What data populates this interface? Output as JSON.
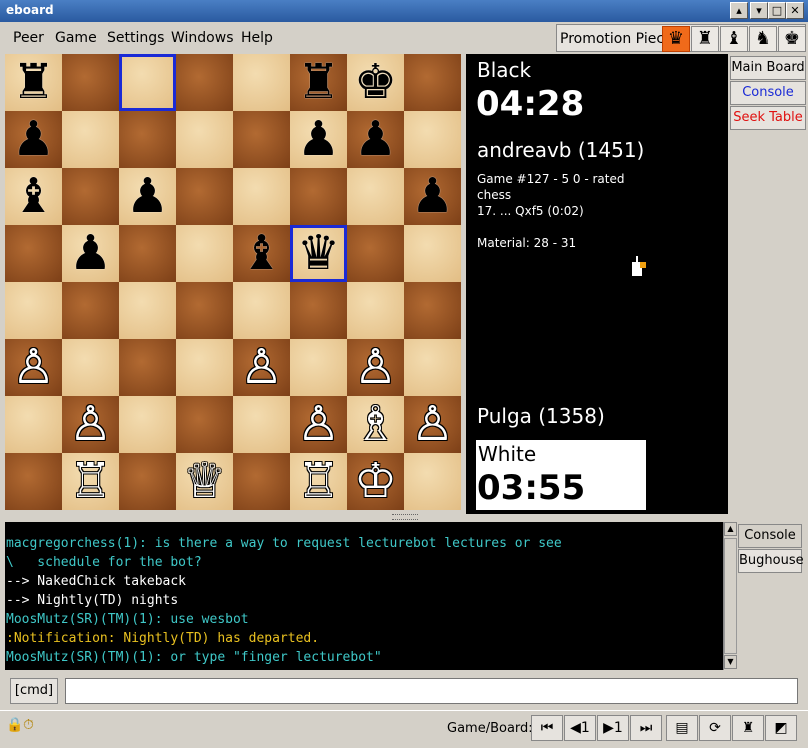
{
  "window": {
    "title": "eboard",
    "min_icon": "▾",
    "max_icon": "□",
    "close_icon": "✕",
    "shade_icon": "▴"
  },
  "menubar": {
    "items": [
      {
        "label": "Peer"
      },
      {
        "label": "Game"
      },
      {
        "label": "Settings"
      },
      {
        "label": "Windows"
      },
      {
        "label": "Help"
      }
    ]
  },
  "promotion": {
    "label": "Promotion Piece",
    "pieces": [
      "♛",
      "♜",
      "♝",
      "♞",
      "♚"
    ],
    "selected": 0
  },
  "board": {
    "rows": [
      [
        "♜",
        "",
        "",
        "",
        "",
        "♜",
        "♚",
        ""
      ],
      [
        "♟",
        "",
        "",
        "",
        "",
        "♟",
        "♟",
        ""
      ],
      [
        "♝",
        "",
        "♟",
        "",
        "",
        "",
        "",
        "♟"
      ],
      [
        "",
        "♟",
        "",
        "",
        "♝",
        "♛",
        "",
        ""
      ],
      [
        "",
        "",
        "",
        "",
        "",
        "",
        "",
        ""
      ],
      [
        "♙",
        "",
        "",
        "",
        "♙",
        "",
        "♙",
        ""
      ],
      [
        "",
        "♙",
        "",
        "",
        "",
        "♙",
        "♗",
        "♙"
      ],
      [
        "",
        "♖",
        "",
        "♕",
        "",
        "♖",
        "♔",
        ""
      ]
    ],
    "colors": [
      [
        "b",
        "",
        "",
        "",
        "",
        "b",
        "b",
        ""
      ],
      [
        "b",
        "",
        "",
        "",
        "",
        "b",
        "b",
        ""
      ],
      [
        "b",
        "",
        "b",
        "",
        "",
        "",
        "",
        "b"
      ],
      [
        "",
        "b",
        "",
        "",
        "b",
        "b",
        "",
        ""
      ],
      [
        "",
        "",
        "",
        "",
        "",
        "",
        "",
        ""
      ],
      [
        "w",
        "",
        "",
        "",
        "w",
        "",
        "w",
        ""
      ],
      [
        "",
        "w",
        "",
        "",
        "",
        "w",
        "w",
        "w"
      ],
      [
        "",
        "w",
        "",
        "w",
        "",
        "w",
        "w",
        ""
      ]
    ],
    "highlight": [
      [
        0,
        2
      ],
      [
        3,
        5
      ]
    ],
    "highlight_color": "#1a2ad6"
  },
  "info": {
    "top_side": "Black",
    "top_clock": "04:28",
    "top_player": "andreavb (1451)",
    "game_line1": "Game #127 - 5 0 - rated",
    "game_line2": "chess",
    "last_move": "17. ... Qxf5 (0:02)",
    "material": "Material: 28 - 31",
    "bottom_player": "Pulga (1358)",
    "bottom_side": "White",
    "bottom_clock": "03:55"
  },
  "side_buttons": {
    "main_board": "Main Board",
    "console": "Console",
    "seek_table": "Seek Table",
    "console_color": "#1a2ad6",
    "seek_color": "#e01010"
  },
  "console": {
    "lines": [
      {
        "text": "macgregorchess(1): is there a way to request lecturebot lectures or see",
        "color": "#3fc8c8"
      },
      {
        "text": "\\   schedule for the bot?",
        "color": "#3fc8c8"
      },
      {
        "text": "--> NakedChick takeback",
        "color": "#ffffff"
      },
      {
        "text": "--> Nightly(TD) nights",
        "color": "#ffffff"
      },
      {
        "text": "MoosMutz(SR)(TM)(1): use wesbot",
        "color": "#3fc8c8"
      },
      {
        "text": ":Notification: Nightly(TD) has departed.",
        "color": "#e8c020"
      },
      {
        "text": "MoosMutz(SR)(TM)(1): or type \"finger lecturebot\"",
        "color": "#3fc8c8"
      }
    ],
    "tab_console": "Console",
    "tab_bughouse": "Bughouse"
  },
  "command": {
    "button": "[cmd]",
    "value": ""
  },
  "status": {
    "label": "Game/Board:",
    "lock_icon": "🔒",
    "clock_icon": "⏱",
    "nav": [
      "⏮",
      "◀1",
      "▶1",
      "⏭"
    ],
    "tools": [
      "▤",
      "⟳",
      "♜",
      "◩"
    ]
  }
}
